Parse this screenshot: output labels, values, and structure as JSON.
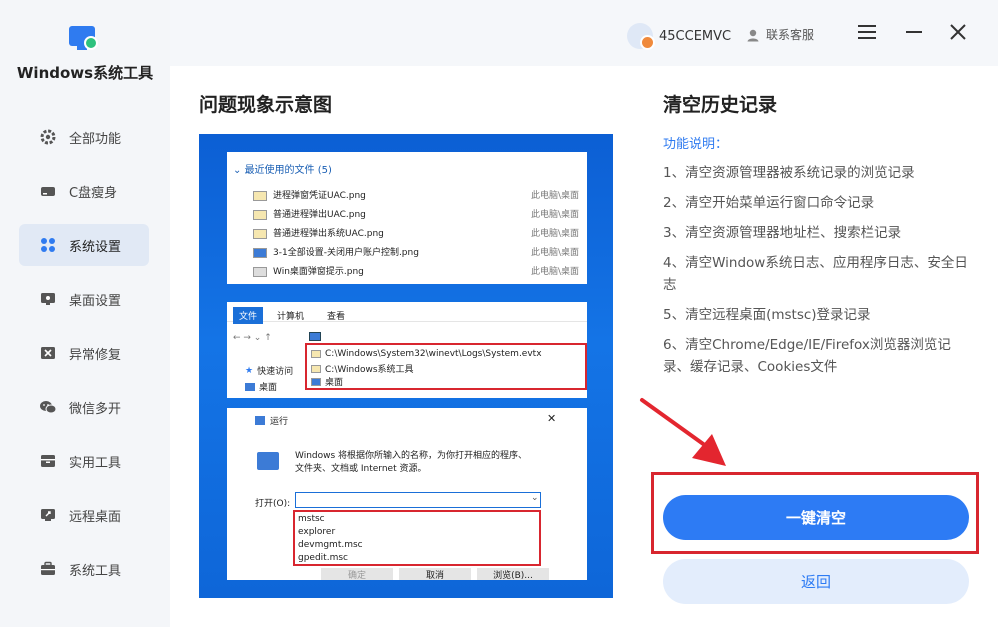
{
  "app": {
    "title": "Windows系统工具"
  },
  "sidebar": {
    "items": [
      {
        "label": "全部功能",
        "icon": "gear-icon"
      },
      {
        "label": "C盘瘦身",
        "icon": "disk-icon"
      },
      {
        "label": "系统设置",
        "icon": "grid-icon",
        "active": true
      },
      {
        "label": "桌面设置",
        "icon": "desktop-icon"
      },
      {
        "label": "异常修复",
        "icon": "repair-icon"
      },
      {
        "label": "微信多开",
        "icon": "wechat-icon"
      },
      {
        "label": "实用工具",
        "icon": "toolbox-icon"
      },
      {
        "label": "远程桌面",
        "icon": "remote-icon"
      },
      {
        "label": "系统工具",
        "icon": "briefcase-icon"
      }
    ]
  },
  "header": {
    "username": "45CCEMVC",
    "service_label": "联系客服"
  },
  "left": {
    "title": "问题现象示意图"
  },
  "demo": {
    "recent": {
      "header": "最近使用的文件 (5)",
      "files": [
        {
          "name": "进程弹窗凭证UAC.png",
          "loc": "此电脑\\桌面"
        },
        {
          "name": "普通进程弹出UAC.png",
          "loc": "此电脑\\桌面"
        },
        {
          "name": "普通进程弹出系统UAC.png",
          "loc": "此电脑\\桌面"
        },
        {
          "name": "3-1全部设置-关闭用户账户控制.png",
          "loc": "此电脑\\桌面"
        },
        {
          "name": "Win桌面弹窗提示.png",
          "loc": "此电脑\\桌面"
        }
      ]
    },
    "explorer": {
      "tabs": [
        "文件",
        "计算机",
        "查看"
      ],
      "quick_access": "快速访问",
      "desktop": "桌面",
      "history": [
        "C:\\Windows\\System32\\winevt\\Logs\\System.evtx",
        "C:\\Windows系统工具",
        "桌面"
      ]
    },
    "run": {
      "title": "运行",
      "desc_line1": "Windows 将根据你所输入的名称，为你打开相应的程序、",
      "desc_line2": "文件夹、文档或 Internet 资源。",
      "open_label": "打开(O):",
      "history": [
        "mstsc",
        "explorer",
        "devmgmt.msc",
        "gpedit.msc"
      ],
      "ok": "确定",
      "cancel": "取消",
      "browse": "浏览(B)..."
    }
  },
  "right": {
    "title": "清空历史记录",
    "func_title": "功能说明：",
    "items": [
      "1、清空资源管理器被系统记录的浏览记录",
      "2、清空开始菜单运行窗口命令记录",
      "3、清空资源管理器地址栏、搜索栏记录",
      "4、清空Window系统日志、应用程序日志、安全日志",
      "5、清空远程桌面(mstsc)登录记录",
      "6、清空Chrome/Edge/IE/Firefox浏览器浏览记录、缓存记录、Cookies文件"
    ],
    "primary_button": "一键清空",
    "back_button": "返回"
  }
}
